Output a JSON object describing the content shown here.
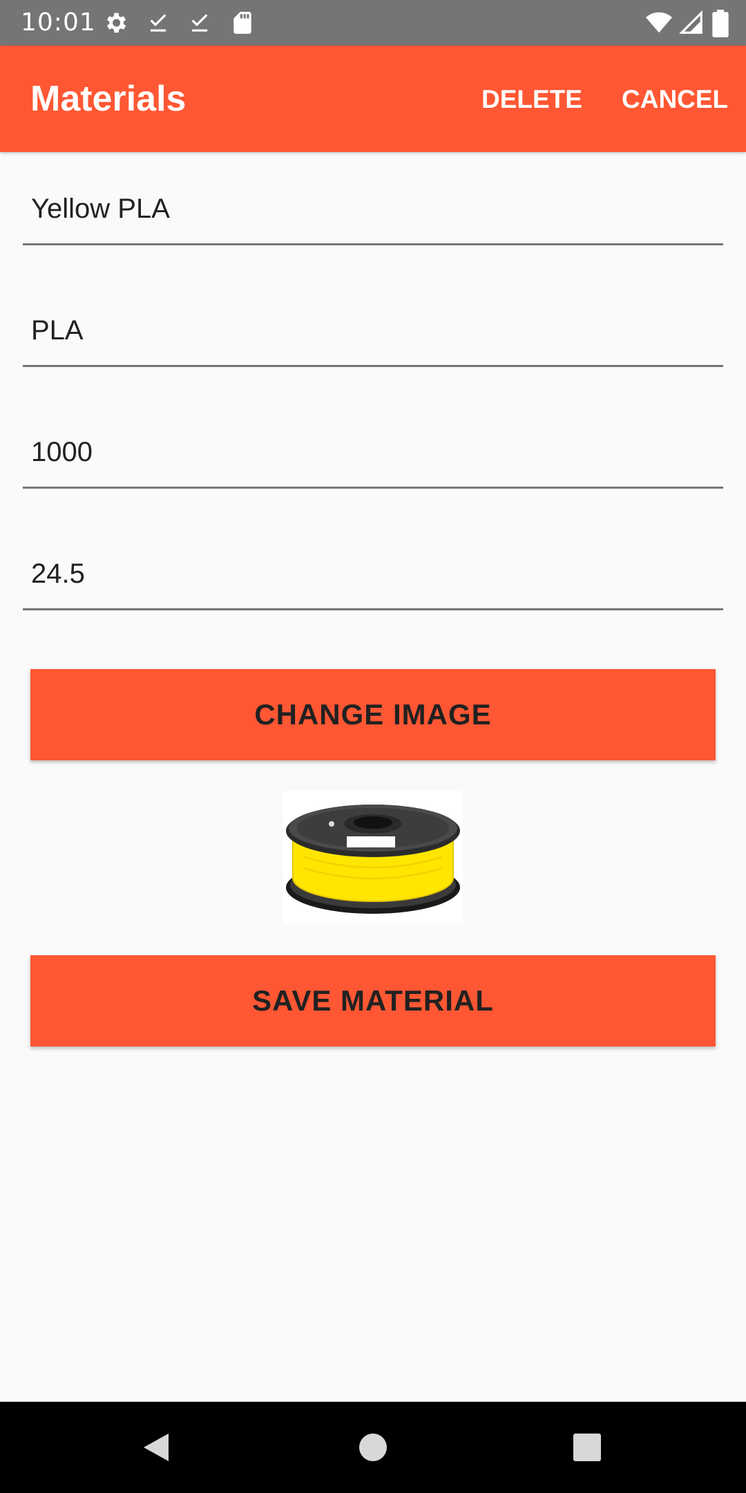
{
  "status_bar": {
    "time": "10:01",
    "icons": [
      "settings-icon",
      "download-done-icon",
      "download-done-icon",
      "sd-card-icon",
      "wifi-icon",
      "signal-icon",
      "battery-icon"
    ]
  },
  "app_bar": {
    "title": "Materials",
    "delete_label": "DELETE",
    "cancel_label": "CANCEL",
    "color": "#ff5733"
  },
  "form": {
    "name_value": "Yellow PLA",
    "type_value": "PLA",
    "weight_value": "1000",
    "price_value": "24.5"
  },
  "buttons": {
    "change_image_label": "CHANGE IMAGE",
    "save_label": "SAVE MATERIAL"
  },
  "image": {
    "description": "yellow-filament-spool",
    "spool_color": "#ffe600"
  },
  "nav_bar": {
    "icons": [
      "back-icon",
      "home-icon",
      "recents-icon"
    ]
  }
}
